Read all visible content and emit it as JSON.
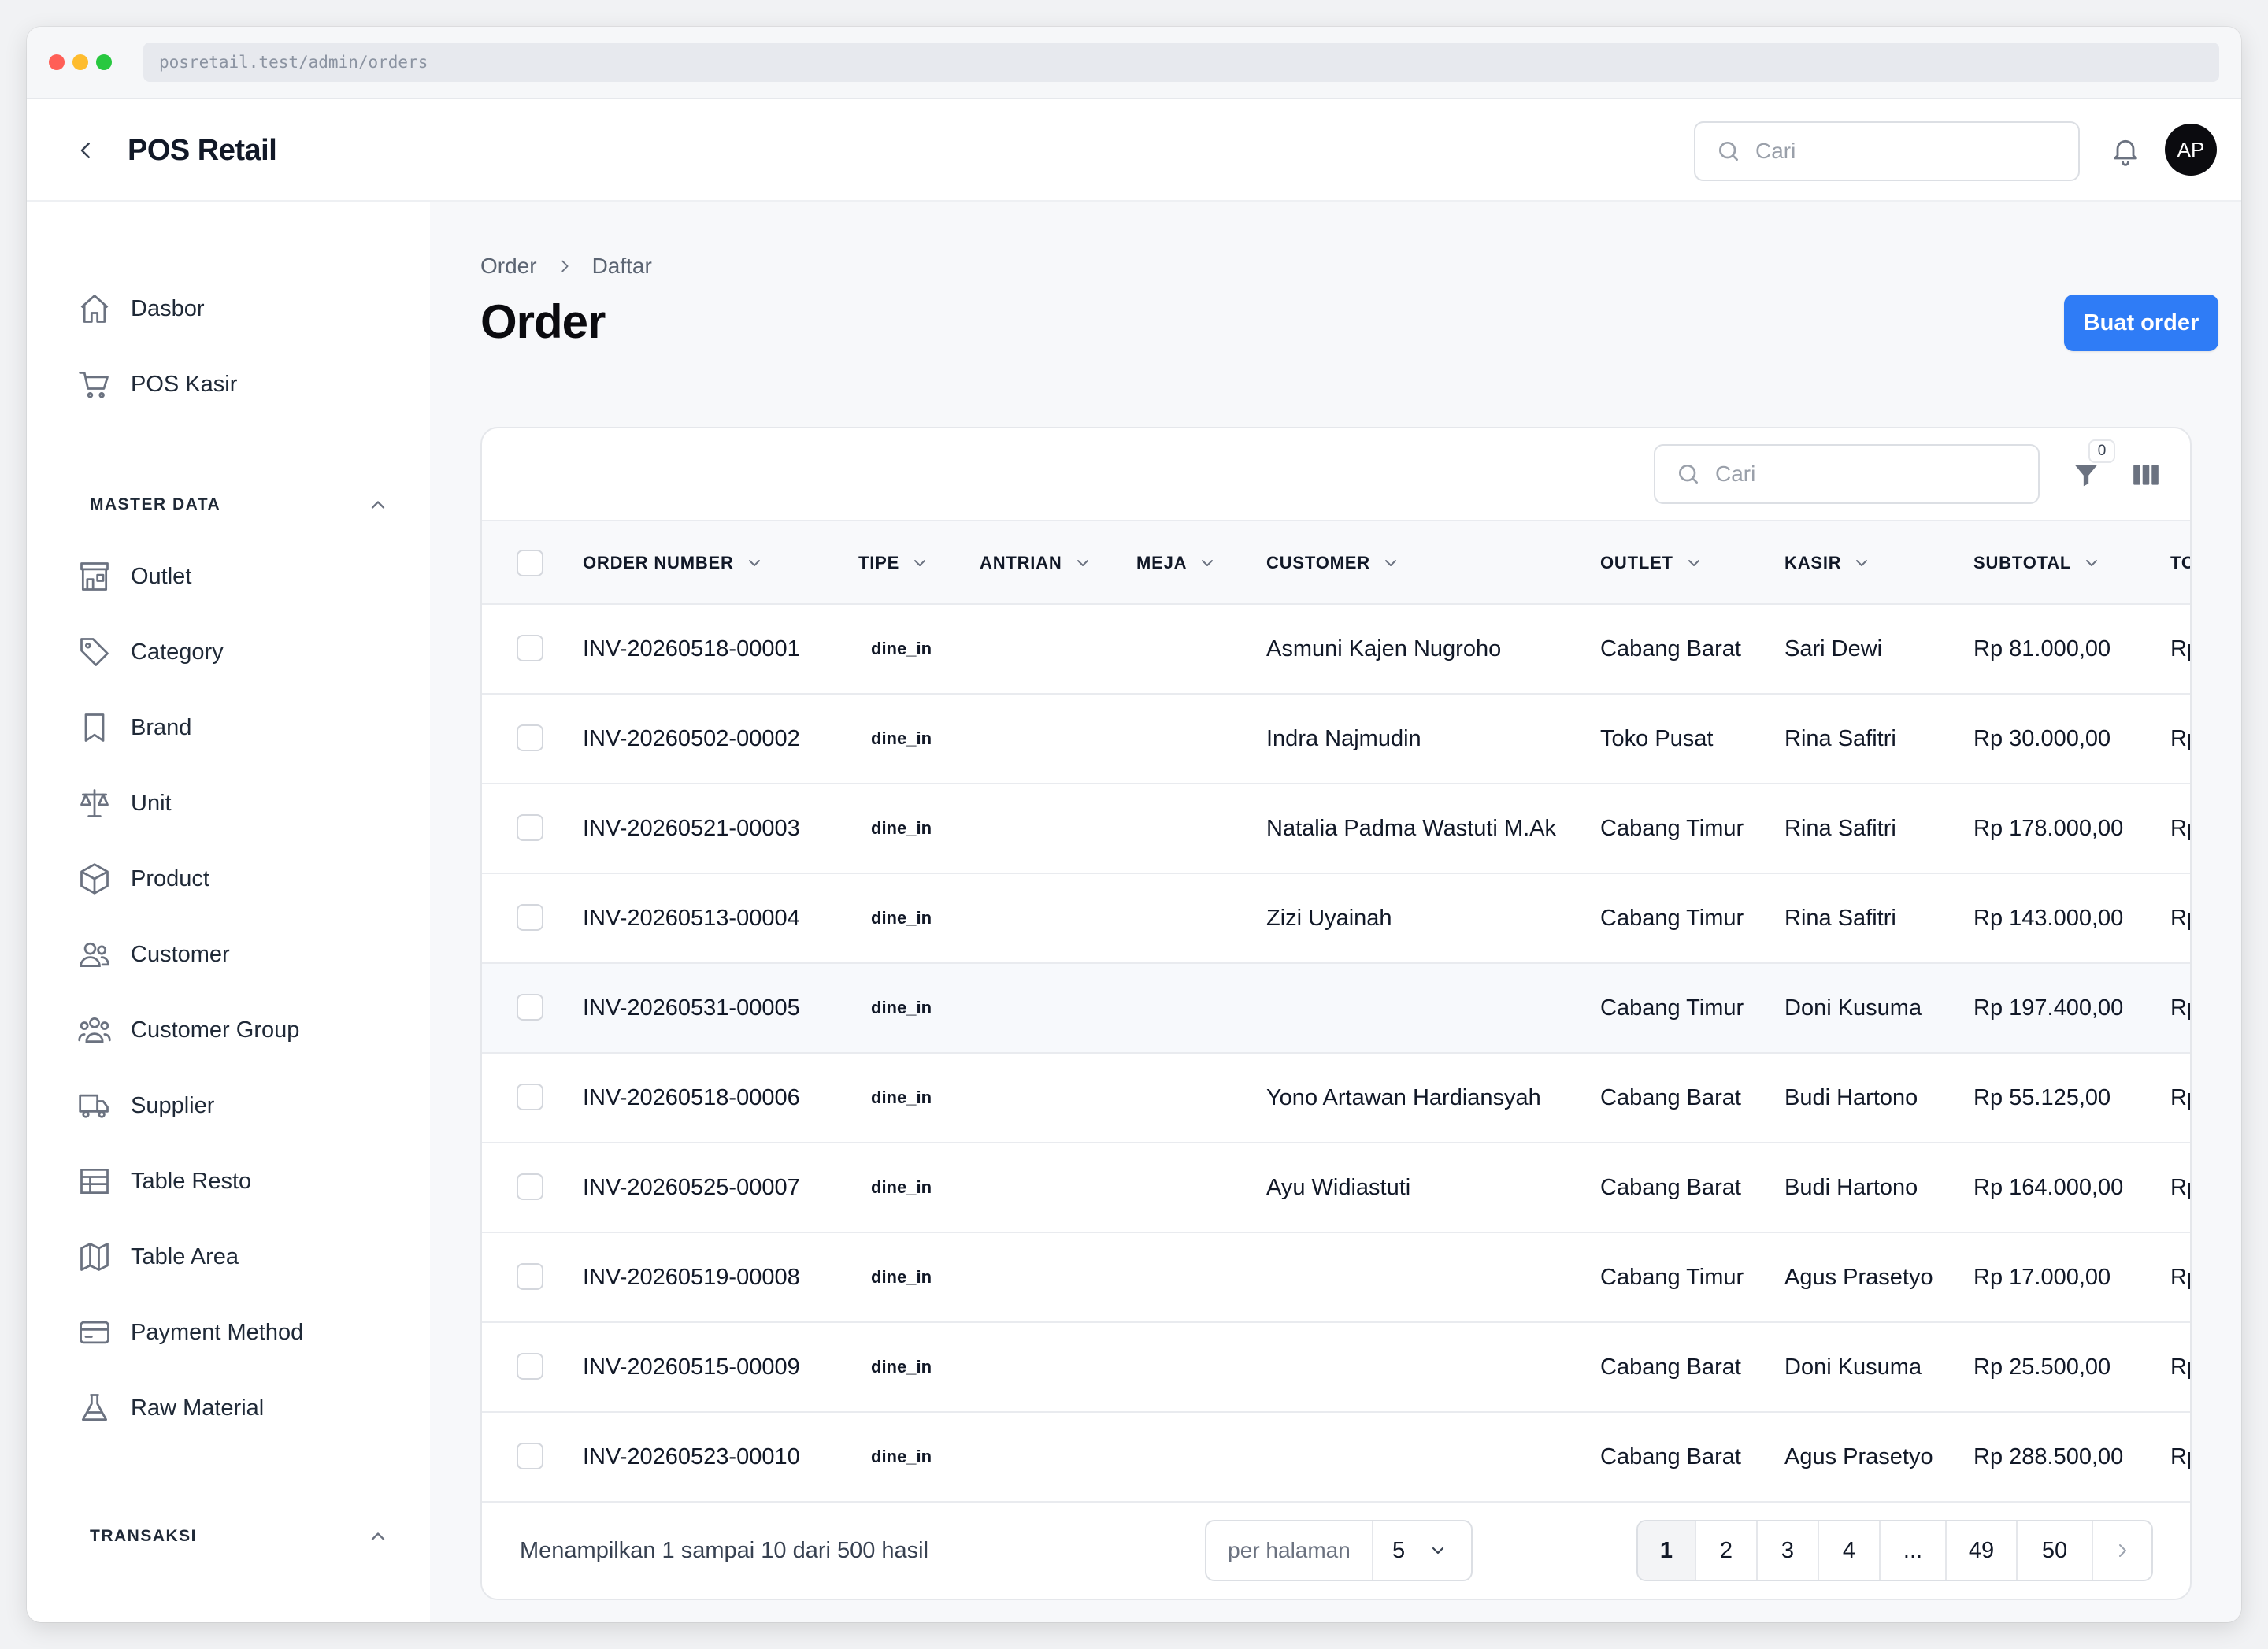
{
  "browser": {
    "url": "posretail.test/admin/orders"
  },
  "header": {
    "app_title": "POS Retail",
    "search_placeholder": "Cari",
    "avatar_initials": "AP"
  },
  "sidebar": {
    "top_items": [
      {
        "label": "Dasbor",
        "icon": "home-icon"
      },
      {
        "label": "POS Kasir",
        "icon": "cart-icon"
      }
    ],
    "master_data": {
      "title": "MASTER DATA",
      "items": [
        {
          "label": "Outlet",
          "icon": "store-icon"
        },
        {
          "label": "Category",
          "icon": "tag-icon"
        },
        {
          "label": "Brand",
          "icon": "bookmark-icon"
        },
        {
          "label": "Unit",
          "icon": "scale-icon"
        },
        {
          "label": "Product",
          "icon": "cube-icon"
        },
        {
          "label": "Customer",
          "icon": "users-icon"
        },
        {
          "label": "Customer Group",
          "icon": "user-group-icon"
        },
        {
          "label": "Supplier",
          "icon": "truck-icon"
        },
        {
          "label": "Table Resto",
          "icon": "table-icon"
        },
        {
          "label": "Table Area",
          "icon": "map-icon"
        },
        {
          "label": "Payment Method",
          "icon": "credit-card-icon"
        },
        {
          "label": "Raw Material",
          "icon": "beaker-icon"
        }
      ]
    },
    "transaksi": {
      "title": "TRANSAKSI"
    }
  },
  "main": {
    "breadcrumb": [
      "Order",
      "Daftar"
    ],
    "title": "Order",
    "create_button": "Buat order",
    "table": {
      "search_placeholder": "Cari",
      "filter_count": "0",
      "columns": [
        "ORDER NUMBER",
        "TIPE",
        "ANTRIAN",
        "MEJA",
        "CUSTOMER",
        "OUTLET",
        "KASIR",
        "SUBTOTAL",
        "TO"
      ],
      "rows": [
        {
          "order_number": "INV-20260518-00001",
          "tipe": "dine_in",
          "antrian": "",
          "meja": "",
          "customer": "Asmuni Kajen Nugroho",
          "outlet": "Cabang Barat",
          "kasir": "Sari Dewi",
          "subtotal": "Rp 81.000,00",
          "total": "Rp"
        },
        {
          "order_number": "INV-20260502-00002",
          "tipe": "dine_in",
          "antrian": "",
          "meja": "",
          "customer": "Indra Najmudin",
          "outlet": "Toko Pusat",
          "kasir": "Rina Safitri",
          "subtotal": "Rp 30.000,00",
          "total": "Rp"
        },
        {
          "order_number": "INV-20260521-00003",
          "tipe": "dine_in",
          "antrian": "",
          "meja": "",
          "customer": "Natalia Padma Wastuti M.Ak",
          "outlet": "Cabang Timur",
          "kasir": "Rina Safitri",
          "subtotal": "Rp 178.000,00",
          "total": "Rp"
        },
        {
          "order_number": "INV-20260513-00004",
          "tipe": "dine_in",
          "antrian": "",
          "meja": "",
          "customer": "Zizi Uyainah",
          "outlet": "Cabang Timur",
          "kasir": "Rina Safitri",
          "subtotal": "Rp 143.000,00",
          "total": "Rp"
        },
        {
          "order_number": "INV-20260531-00005",
          "tipe": "dine_in",
          "antrian": "",
          "meja": "",
          "customer": "",
          "outlet": "Cabang Timur",
          "kasir": "Doni Kusuma",
          "subtotal": "Rp 197.400,00",
          "total": "Rp"
        },
        {
          "order_number": "INV-20260518-00006",
          "tipe": "dine_in",
          "antrian": "",
          "meja": "",
          "customer": "Yono Artawan Hardiansyah",
          "outlet": "Cabang Barat",
          "kasir": "Budi Hartono",
          "subtotal": "Rp 55.125,00",
          "total": "Rp"
        },
        {
          "order_number": "INV-20260525-00007",
          "tipe": "dine_in",
          "antrian": "",
          "meja": "",
          "customer": "Ayu Widiastuti",
          "outlet": "Cabang Barat",
          "kasir": "Budi Hartono",
          "subtotal": "Rp 164.000,00",
          "total": "Rp"
        },
        {
          "order_number": "INV-20260519-00008",
          "tipe": "dine_in",
          "antrian": "",
          "meja": "",
          "customer": "",
          "outlet": "Cabang Timur",
          "kasir": "Agus Prasetyo",
          "subtotal": "Rp 17.000,00",
          "total": "Rp"
        },
        {
          "order_number": "INV-20260515-00009",
          "tipe": "dine_in",
          "antrian": "",
          "meja": "",
          "customer": "",
          "outlet": "Cabang Barat",
          "kasir": "Doni Kusuma",
          "subtotal": "Rp 25.500,00",
          "total": "Rp"
        },
        {
          "order_number": "INV-20260523-00010",
          "tipe": "dine_in",
          "antrian": "",
          "meja": "",
          "customer": "",
          "outlet": "Cabang Barat",
          "kasir": "Agus Prasetyo",
          "subtotal": "Rp 288.500,00",
          "total": "Rp"
        }
      ],
      "footer": {
        "summary": "Menampilkan 1 sampai 10 dari 500 hasil",
        "per_page_label": "per halaman",
        "per_page_value": "5",
        "pages": [
          "1",
          "2",
          "3",
          "4",
          "...",
          "49",
          "50"
        ],
        "active_page": "1"
      }
    }
  },
  "colors": {
    "primary": "#2f7cf6",
    "avatar_bg": "#0b0b0f"
  }
}
